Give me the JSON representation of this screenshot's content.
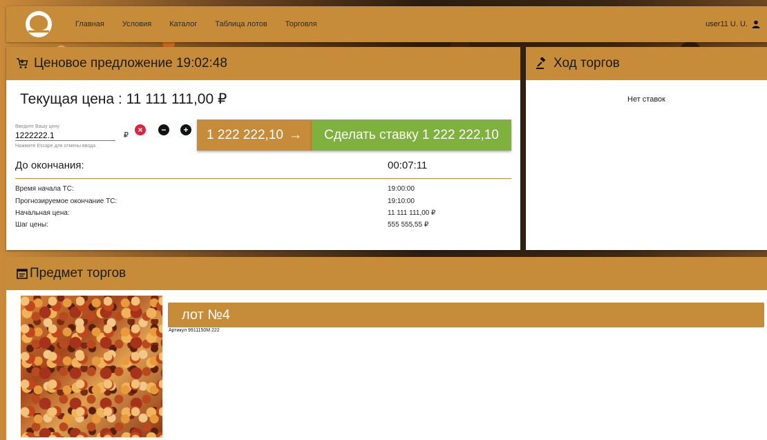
{
  "nav": {
    "items": [
      "Главная",
      "Условия",
      "Каталог",
      "Таблица лотов",
      "Торговля"
    ],
    "user": "user11 U. U."
  },
  "bid_panel": {
    "title": "Ценовое предложение 19:02:48",
    "current_price": "Текущая цена : 11 111 111,00 ₽",
    "input_placeholder": "Введите Вашу цену",
    "input_value": "1222222.1",
    "currency": "₽",
    "input_hint": "Нажмите Escape для отмены ввода",
    "price_button": "1 222 222,10",
    "bid_button": "Сделать ставку 1 222 222,10",
    "until_label": "До окончания:",
    "until_value": "00:07:11",
    "info": [
      {
        "label": "Время начала ТС:",
        "value": "19:00:00"
      },
      {
        "label": "Прогнозируемое окончание ТС:",
        "value": "19:10:00"
      },
      {
        "label": "Начальная цена:",
        "value": "11 111 111,00 ₽"
      },
      {
        "label": "Шаг цены:",
        "value": "555 555,55 ₽"
      }
    ]
  },
  "history_panel": {
    "title": "Ход торгов",
    "empty": "Нет ставок"
  },
  "subject_panel": {
    "title": "Предмет торгов",
    "lot_title": "лот №4",
    "article": "Артикул 9911150M 222"
  },
  "colors": {
    "accent": "#c68c39",
    "bid_green": "#7fb13f",
    "cancel_red": "#d7263d"
  }
}
